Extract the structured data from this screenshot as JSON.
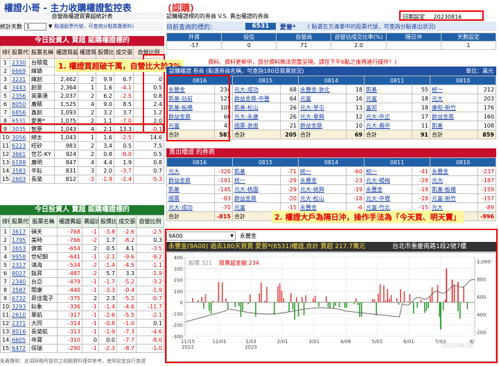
{
  "title": {
    "main": "權證小哥 - 主力收購權證監控表",
    "tag": "(認購)"
  },
  "subhead": {
    "left": "自營商權證買賣超統計表",
    "mid": "認購權證標的的券商 V.S. 賣出權證的券商",
    "date_label": "日期設定",
    "date": "20230816"
  },
  "stats": {
    "label": "統計天數",
    "value": "1",
    "hint": "點選股票代號，可查詢分點買賣資料)"
  },
  "query": {
    "label": "目前查詢的標的：",
    "code": "6531",
    "name": "愛普*",
    "hint": "( 點選左方清單中的股票代號，可查詢分點進出狀況)"
  },
  "summary": {
    "headers": [
      "外資",
      "投信",
      "自營商",
      "自營佔成交比率(%)",
      "隔日沖",
      "天數設定"
    ],
    "values": [
      "-17",
      "0",
      "71",
      "2.0",
      "",
      "1"
    ]
  },
  "scroll_note": "資料、資料更新中，部分資料無法完整呈現，請在下午6點之後再進行操作！)",
  "buy_bar": {
    "title": "今日投資人 買超 認購權證標的",
    "headers": [
      "排行",
      "股票代號",
      "股票名稱",
      "權證買超(千元)",
      "權證買超比率%",
      "股價比率%",
      "成交張數(%)",
      "自營比例"
    ]
  },
  "buy_rows": [
    [
      "1",
      "2330",
      "台積電",
      "",
      "",
      "",
      "",
      ""
    ],
    [
      "2",
      "6669",
      "緯穎",
      "",
      "",
      "",
      "",
      ""
    ],
    [
      "3",
      "3231",
      "緯創",
      "2,462",
      "2",
      "9.9",
      "6.7",
      "0"
    ],
    [
      "4",
      "3443",
      "創意",
      "2,364",
      "1",
      "1.6",
      "-4.1",
      "0.5"
    ],
    [
      "5",
      "2356",
      "英業達",
      "2,037",
      "2",
      "6.2",
      "-2.5",
      "0.8"
    ],
    [
      "6",
      "8050",
      "廣積",
      "1,525",
      "4",
      "9.0",
      "8.5",
      "2.4"
    ],
    [
      "7",
      "6856",
      "鑫創",
      "1,093",
      "2",
      "3.2",
      "3.7",
      "1.2"
    ],
    [
      "8",
      "6531",
      "愛普*",
      "1,075",
      "2",
      "1.1",
      "-7.0",
      "2.0"
    ],
    [
      "9",
      "3035",
      "智原",
      "1,043",
      "4",
      "2.1",
      "13.3",
      "-0.1"
    ],
    [
      "10",
      "3056",
      "總太",
      "1,043",
      "1",
      "1.6",
      "-2.5",
      "14.6"
    ],
    [
      "11",
      "6223",
      "旺矽",
      "983",
      "2",
      "3.4",
      "0.5",
      "7.5"
    ],
    [
      "12",
      "3661",
      "世芯-KY",
      "924",
      "2",
      "0.8",
      "-8.0",
      "0.5"
    ],
    [
      "13",
      "6188",
      "廣明",
      "847",
      "4",
      "4.4",
      "1.9",
      "0.8"
    ],
    [
      "14",
      "3583",
      "辛耘",
      "831",
      "3",
      "2.0",
      "-3.7",
      "0.7"
    ],
    [
      "15",
      "2603",
      "長榮",
      "812",
      "-3",
      "-1.9",
      "-2.4",
      "-5.3"
    ]
  ],
  "callout1": "1. 權證買超破千萬，自營比大於2%",
  "sell_bar": {
    "title": "今日投資人 賣超 認購權證標的",
    "headers": [
      "排行",
      "股票代號",
      "股票名稱",
      "權證賣超(千元)",
      "賣超比率%",
      "股價比率%",
      "成交張數(%)",
      "自營比例"
    ]
  },
  "sell_rows": [
    [
      "1",
      "3617",
      "碩天",
      "-768",
      "-1",
      "-3.8",
      "-2.6",
      "-2.5"
    ],
    [
      "2",
      "1795",
      "美時",
      "-766",
      "-2",
      "1.7",
      "-8.2",
      "0.3"
    ],
    [
      "3",
      "3653",
      "健策",
      "-654",
      "2",
      "0.5",
      "4.1",
      "-3.5"
    ],
    [
      "4",
      "9958",
      "世紀鋼",
      "-641",
      "-1",
      "-2.1",
      "-9.6",
      "-9.2"
    ],
    [
      "5",
      "2317",
      "鴻海",
      "-534",
      "-2",
      "-1.4",
      "-4.5",
      "-1.1"
    ],
    [
      "6",
      "8027",
      "鈦昇",
      "-487",
      "-2",
      "5.7",
      "3.3",
      "-1.9"
    ],
    [
      "7",
      "2340",
      "台亞",
      "-479",
      "-1",
      "-1.7",
      "-5.2",
      "-3.2"
    ],
    [
      "8",
      "3587",
      "閎康",
      "-440",
      "-1",
      "-3.3",
      "-0.4",
      "-1.9"
    ],
    [
      "9",
      "6732",
      "昇佳電子",
      "-375",
      "2",
      "2.3",
      "-5.2",
      "-0.7"
    ],
    [
      "10",
      "3293",
      "鈊象",
      "-336",
      "-1",
      "-1.4",
      "-4.6",
      "-11.7"
    ],
    [
      "11",
      "2610",
      "華航",
      "-317",
      "-1",
      "-2.6",
      "-5.5",
      "-2.1"
    ],
    [
      "12",
      "2371",
      "大同",
      "-314",
      "-1",
      "-0.8",
      "-1.0",
      "0.1"
    ],
    [
      "13",
      "8016",
      "長榮航",
      "-313",
      "-1",
      "-1.9",
      "-7.3",
      "-4.6"
    ],
    [
      "14",
      "6605",
      "帝寶",
      "-310",
      "0",
      "0.0",
      "-7.7",
      "-8.0"
    ],
    [
      "15",
      "6472",
      "保瑞",
      "-290",
      "-1",
      "-2.3",
      "-8.7",
      "-1.0"
    ]
  ],
  "footer": "免責聲明：此項財務所提供之相關資料僅供參考，使用前宜自行查證",
  "buy_brokers_bar": "認購權證 券商 (點選券商名稱，可查詢180日買賣狀況)",
  "unit": "單位：萬元",
  "dates": [
    "0816",
    "0815",
    "0814",
    "0811",
    "0810"
  ],
  "buy_brokers": [
    [
      [
        "永豐金",
        "234"
      ],
      [
        "凱基-站前",
        "125"
      ],
      [
        "凱基-板橋",
        "109"
      ],
      [
        "群益金鼎",
        "66"
      ],
      [
        "元富",
        "47"
      ]
    ],
    [
      [
        "元大-成功",
        "68"
      ],
      [
        "群益金鼎-中豐",
        "64"
      ],
      [
        "凱基-松山",
        "26"
      ],
      [
        "元大-永康",
        "26"
      ],
      [
        "國票-敦南",
        "21"
      ]
    ],
    [
      [
        "永豐金-敦北",
        "18"
      ],
      [
        "元富",
        "16"
      ],
      [
        "元大-草屯",
        "13"
      ],
      [
        "元大-華興",
        "12"
      ],
      [
        "群益金鼎",
        "10"
      ]
    ],
    [
      [
        "凱基",
        "55"
      ],
      [
        "元富",
        "18"
      ],
      [
        "富邦",
        "18"
      ],
      [
        "元大-中正",
        "17"
      ],
      [
        "元大-鳳中",
        "11"
      ]
    ],
    [
      [
        "統一",
        "212"
      ],
      [
        "元大",
        "203"
      ],
      [
        "康和-新竹",
        "176"
      ],
      [
        "群益金鼎",
        "160"
      ],
      [
        "凱基",
        "108"
      ]
    ]
  ],
  "buy_totals": [
    "581",
    "205",
    "69",
    "91",
    "859"
  ],
  "sell_brokers_bar": "賣出權證 的券商",
  "sell_brokers": [
    [
      [
        "元大",
        "-326"
      ],
      [
        "群益金鼎",
        "-191"
      ],
      [
        "凱基",
        "-145"
      ],
      [
        "國票",
        "-83"
      ],
      [
        "元大-成功",
        "-70"
      ]
    ],
    [
      [
        "凱基",
        "-71"
      ],
      [
        "統一",
        "-29"
      ],
      [
        "元大-桃園",
        "-29"
      ],
      [
        "群益金鼎",
        "-20"
      ],
      [
        "元富",
        "-15"
      ]
    ],
    [
      [
        "統一",
        "-60"
      ],
      [
        "永豐金",
        "-23"
      ],
      [
        "元大-桃興",
        "-19"
      ],
      [
        "元大-松山",
        "-18"
      ],
      [
        "永豐金",
        "-6"
      ]
    ],
    [
      [
        "統一",
        "-41"
      ],
      [
        "元大-楊梅",
        "-28"
      ],
      [
        "永豐金",
        "-19"
      ],
      [
        "元大-中壢",
        "-18"
      ],
      [
        "元富-竹北",
        "-15"
      ]
    ],
    [
      [
        "永豐金",
        "-237"
      ],
      [
        "元大",
        "-187"
      ],
      [
        "凱基-板橋",
        "-159"
      ],
      [
        "元富-新竹",
        "-157"
      ],
      [
        "元大",
        "-89"
      ]
    ]
  ],
  "sell_totals": [
    "-815",
    "-194",
    "-46",
    "-189",
    "-996"
  ],
  "callout2": "2. 權證大戶為隔日沖，操作手法為「今天買、明天賣」",
  "chart_panel": {
    "selector_code": "9A00",
    "selector_name": "永豐金",
    "title": "永豐金(9A00) 過去180天買賣 愛普*(6531)權證,合計 賣超 217.7萬元",
    "address": "台北市重慶南路1段2號7樓",
    "legend_price": "股價 321",
    "legend_net": "買賣超金額 234",
    "watermark": "2023/08/16"
  },
  "chart_data": {
    "type": "bar",
    "x_ticks": [
      "11/15\n2022",
      "12/01",
      "1/03\n2023",
      "2/01",
      "3/01",
      "4/06",
      "5/02",
      "6/01",
      "7/03",
      "8/"
    ],
    "y_ticks": [
      "400",
      "300",
      "200",
      "100",
      "0",
      "-100",
      "-200",
      "-300"
    ],
    "price_ticks": [
      "1,000",
      "800",
      "600",
      "400",
      "200"
    ]
  }
}
